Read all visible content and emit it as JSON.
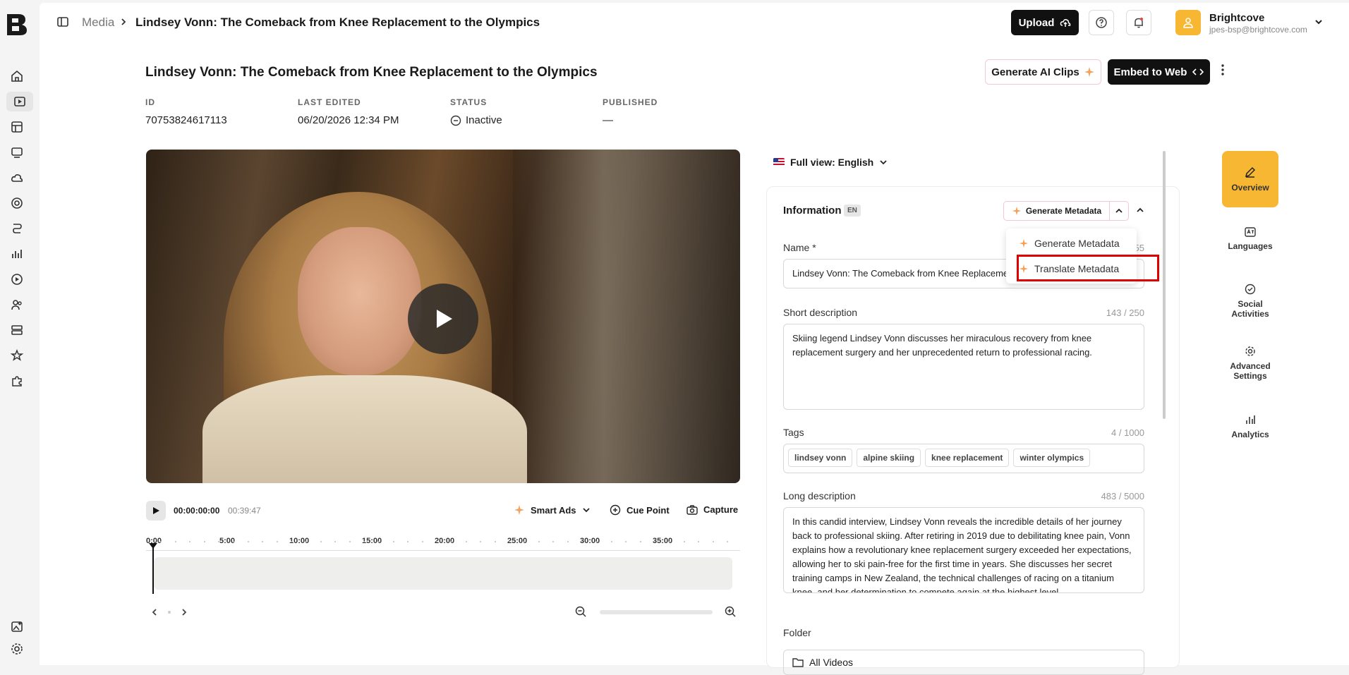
{
  "breadcrumb": {
    "root": "Media",
    "current": "Lindsey Vonn: The Comeback from Knee Replacement to the Olympics"
  },
  "header": {
    "upload_label": "Upload",
    "account_name": "Brightcove",
    "account_email": "jpes-bsp@brightcove.com"
  },
  "page": {
    "title": "Lindsey Vonn: The Comeback from Knee Replacement to the Olympics",
    "generate_ai_clips_label": "Generate AI Clips",
    "embed_label": "Embed to Web"
  },
  "meta": {
    "id_label": "ID",
    "id_value": "70753824617113",
    "edited_label": "LAST EDITED",
    "edited_value": "06/20/2026 12:34 PM",
    "status_label": "STATUS",
    "status_value": "Inactive",
    "published_label": "PUBLISHED",
    "published_value": "—"
  },
  "player": {
    "timecode": "00:00:00:00",
    "duration": "00:39:47",
    "smart_ads_label": "Smart Ads",
    "cue_point_label": "Cue Point",
    "capture_label": "Capture",
    "timeline_ticks": [
      "0:00",
      "5:00",
      "10:00",
      "15:00",
      "20:00",
      "25:00",
      "30:00",
      "35:00"
    ]
  },
  "language_view": "Full view: English",
  "info": {
    "title": "Information",
    "lang_badge": "EN",
    "generate_meta_label": "Generate Metadata",
    "dropdown": [
      "Generate Metadata",
      "Translate Metadata"
    ],
    "name_label": "Name *",
    "name_value": "Lindsey Vonn: The Comeback from Knee Replacement to the Olympics",
    "name_count": "255",
    "short_label": "Short description",
    "short_count": "143 / 250",
    "short_value": "Skiing legend Lindsey Vonn discusses her miraculous recovery from knee replacement surgery and her unprecedented return to professional racing.",
    "tags_label": "Tags",
    "tags_count": "4 / 1000",
    "tags": [
      "lindsey vonn",
      "alpine skiing",
      "knee replacement",
      "winter olympics"
    ],
    "long_label": "Long description",
    "long_count": "483 / 5000",
    "long_value": "In this candid interview, Lindsey Vonn reveals the incredible details of her journey back to professional skiing. After retiring in 2019 due to debilitating knee pain, Vonn explains how a revolutionary knee replacement surgery exceeded her expectations, allowing her to ski pain-free for the first time in years. She discusses her secret training camps in New Zealand, the technical challenges of racing on a titanium knee, and her determination to compete again at the highest level.",
    "folder_label": "Folder",
    "folder_value": "All Videos"
  },
  "right_tabs": [
    "Overview",
    "Languages",
    "Social Activities",
    "Advanced Settings",
    "Analytics"
  ],
  "colors": {
    "accent": "#f7b733",
    "highlight": "#e00000",
    "primary_btn": "#111111"
  }
}
